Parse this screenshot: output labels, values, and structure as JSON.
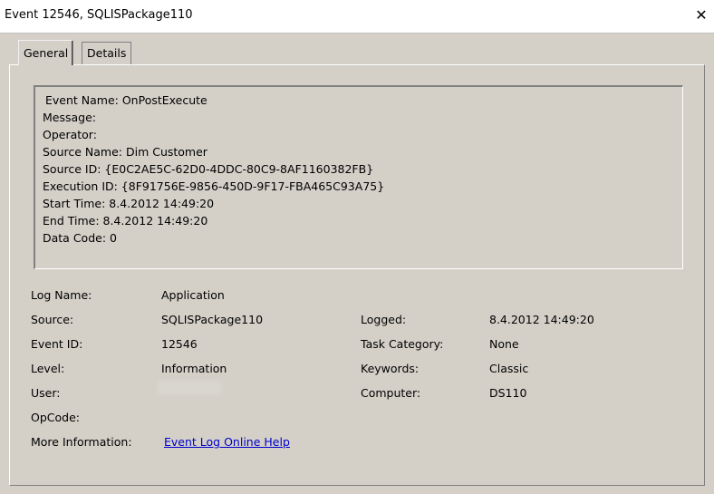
{
  "window": {
    "title": "Event 12546, SQLISPackage110",
    "close_glyph": "✕"
  },
  "tabs": [
    {
      "label": "General",
      "active": true
    },
    {
      "label": "Details",
      "active": false
    }
  ],
  "description": [
    "Event Name: OnPostExecute",
    "Message:",
    "Operator:",
    "Source Name: Dim Customer",
    "Source ID: {E0C2AE5C-62D0-4DDC-80C9-8AF1160382FB}",
    "Execution ID: {8F91756E-9856-450D-9F17-FBA465C93A75}",
    "Start Time: 8.4.2012 14:49:20",
    "End Time: 8.4.2012 14:49:20",
    "Data Code: 0"
  ],
  "fields": {
    "log_name": {
      "label": "Log Name:",
      "value": "Application"
    },
    "source": {
      "label": "Source:",
      "value": "SQLISPackage110"
    },
    "event_id": {
      "label": "Event ID:",
      "value": "12546"
    },
    "level": {
      "label": "Level:",
      "value": "Information"
    },
    "user": {
      "label": "User:",
      "value": ""
    },
    "opcode": {
      "label": "OpCode:",
      "value": ""
    },
    "more_info": {
      "label": "More Information:",
      "value": "Event Log Online Help"
    },
    "logged": {
      "label": "Logged:",
      "value": "8.4.2012 14:49:20"
    },
    "task_category": {
      "label": "Task Category:",
      "value": "None"
    },
    "keywords": {
      "label": "Keywords:",
      "value": "Classic"
    },
    "computer": {
      "label": "Computer:",
      "value": "DS110"
    }
  }
}
